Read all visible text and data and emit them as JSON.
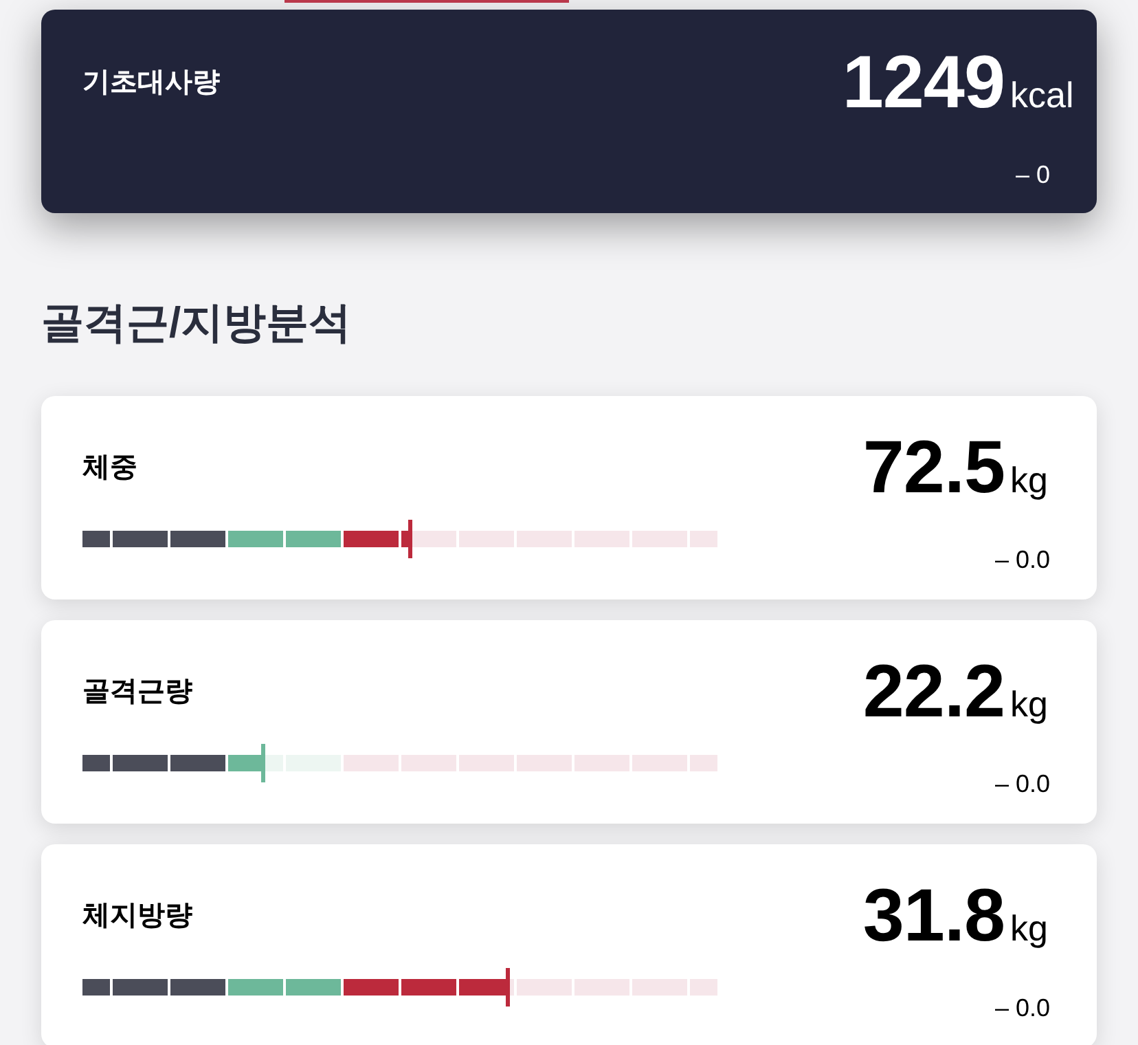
{
  "tabs": [
    {
      "selected": false
    },
    {
      "selected": true
    },
    {
      "selected": false
    },
    {
      "selected": false
    }
  ],
  "basal_metabolic_rate": {
    "label": "기초대사량",
    "value": "1249",
    "unit": "kcal",
    "change": "– 0"
  },
  "section_title": "골격근/지방분석",
  "metrics": [
    {
      "label": "체중",
      "value": "72.5",
      "unit": "kg",
      "change": "– 0.0",
      "level": 0.516
    },
    {
      "label": "골격근량",
      "value": "22.2",
      "unit": "kg",
      "change": "– 0.0",
      "level": 0.284
    },
    {
      "label": "체지방량",
      "value": "31.8",
      "unit": "kg",
      "change": "– 0.0",
      "level": 0.67
    }
  ]
}
